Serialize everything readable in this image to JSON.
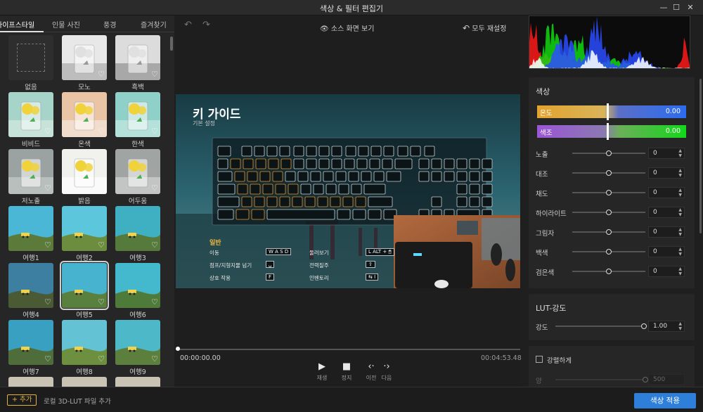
{
  "window": {
    "title": "색상 & 필터 편집기",
    "minimize": "—",
    "maximize": "☐",
    "close": "✕"
  },
  "left_panel": {
    "tabs": [
      {
        "label": "라이프스타일",
        "active": true
      },
      {
        "label": "인물 사진",
        "active": false
      },
      {
        "label": "풍경",
        "active": false
      },
      {
        "label": "즐겨찾기",
        "active": false
      }
    ],
    "filters": [
      {
        "label": "없음",
        "style": "none"
      },
      {
        "label": "모노",
        "style": "mono"
      },
      {
        "label": "흑백",
        "style": "bw"
      },
      {
        "label": "비비드",
        "style": "vivid"
      },
      {
        "label": "온색",
        "style": "warm"
      },
      {
        "label": "한색",
        "style": "cool"
      },
      {
        "label": "저노출",
        "style": "under"
      },
      {
        "label": "밝음",
        "style": "bright"
      },
      {
        "label": "어두움",
        "style": "dark"
      },
      {
        "label": "여행1",
        "style": "t1"
      },
      {
        "label": "여행2",
        "style": "t2"
      },
      {
        "label": "여행3",
        "style": "t3"
      },
      {
        "label": "여행4",
        "style": "t4"
      },
      {
        "label": "여행5",
        "style": "t5",
        "selected": true
      },
      {
        "label": "여행6",
        "style": "t6"
      },
      {
        "label": "여행7",
        "style": "t7"
      },
      {
        "label": "여행8",
        "style": "t8"
      },
      {
        "label": "여행9",
        "style": "t9"
      },
      {
        "label": "",
        "style": "p1"
      },
      {
        "label": "",
        "style": "p2"
      },
      {
        "label": "",
        "style": "p3"
      }
    ]
  },
  "center": {
    "undo_icon": "↶",
    "redo_icon": "↷",
    "source_view_icon": "👁",
    "source_view_label": "소스 화면 보기",
    "reset_icon": "↶",
    "reset_label": "모두 재설정",
    "preview": {
      "title": "키 가이드",
      "subtitle": "기본 설정",
      "section": "일반",
      "controls": [
        {
          "label": "이동",
          "keys": "W A S D"
        },
        {
          "label": "둘러보기",
          "keys": "L ALT + 🖱"
        },
        {
          "label": "점프/지형지물 넘기",
          "keys": "␣"
        },
        {
          "label": "전력질주",
          "keys": "⇧"
        },
        {
          "label": "상호 작용",
          "keys": "F"
        },
        {
          "label": "인벤토리",
          "keys": "⇆ I"
        }
      ]
    },
    "timecode_current": "00:00:00.00",
    "timecode_total": "00:04:53.48",
    "playback": [
      {
        "icon": "▶",
        "label": "재생"
      },
      {
        "icon": "■",
        "label": "정지"
      },
      {
        "icon": "‹·",
        "label": "이전"
      },
      {
        "icon": "·›",
        "label": "다음"
      }
    ]
  },
  "right_panel": {
    "color_section": {
      "title": "색상",
      "temperature": {
        "label": "온도",
        "value": "0.00"
      },
      "tint": {
        "label": "색조",
        "value": "0.00"
      },
      "sliders": [
        {
          "label": "노출",
          "value": "0",
          "level": 0.5
        },
        {
          "label": "대조",
          "value": "0",
          "level": 0.5
        },
        {
          "label": "채도",
          "value": "0",
          "level": 0.5
        },
        {
          "label": "하이라이트",
          "value": "0",
          "level": 0.5
        },
        {
          "label": "그림자",
          "value": "0",
          "level": 0.5
        },
        {
          "label": "백색",
          "value": "0",
          "level": 0.5
        },
        {
          "label": "검은색",
          "value": "0",
          "level": 0.5
        }
      ]
    },
    "lut_section": {
      "title": "LUT-강도",
      "strength_label": "강도",
      "strength_value": "1.00",
      "strength_level": 1.0
    },
    "intense_section": {
      "checkbox_label": "강렬하게",
      "amount_label": "양",
      "amount_value": "500"
    }
  },
  "bottom": {
    "add_button": "+ 추가",
    "add_hint": "로컬 3D-LUT 파일 추가",
    "apply_button": "색상 적용"
  },
  "colors": {
    "accent": "#2e7fd9",
    "add_button": "#e3b43a"
  }
}
